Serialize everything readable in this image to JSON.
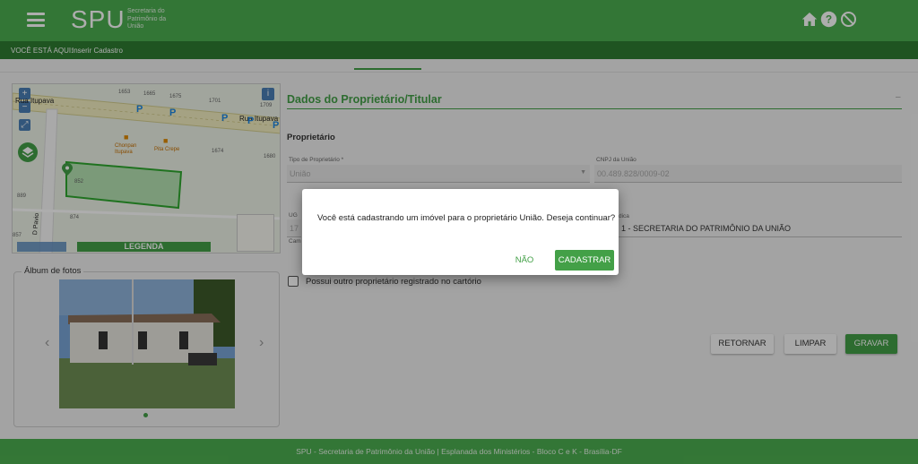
{
  "header": {
    "logo": "SPU",
    "logo_sub": [
      "Secretaria do",
      "Patrimônio da",
      "União"
    ],
    "icons": [
      "home-icon",
      "help-icon",
      "block-icon"
    ]
  },
  "breadcrumb": {
    "where_label": "VOCÊ ESTÁ AQUI:",
    "current": "Inserir Cadastro"
  },
  "map": {
    "street_labels": [
      "Rua Itupava",
      "Rua Itupava",
      "D Pavio"
    ],
    "numbers": [
      "1653",
      "1665",
      "1675",
      "1701",
      "1709",
      "1674",
      "1680",
      "852",
      "889",
      "874",
      "857"
    ],
    "pois": [
      "Chonpan Itupava",
      "Pita Crepe"
    ],
    "legend_label": "LEGENDA",
    "info_icon": "i"
  },
  "album": {
    "title": "Álbum de fotos"
  },
  "form": {
    "section_title": "Dados do Proprietário/Titular",
    "subheading": "Proprietário",
    "tipo_label": "Tipo de Proprietário *",
    "tipo_value": "União",
    "cnpj_label": "CNPJ da União",
    "cnpj_value": "00.489.828/0009-02",
    "ug_label_partial": "UG",
    "ug_value_partial": "17",
    "gestora_label_partial": "dica",
    "gestora_value": "1 - SECRETARIA DO PATRIMÔNIO DA UNIÃO",
    "cam_label_partial": "Cam",
    "checkbox_label": "Possui outro proprietário registrado no cartório"
  },
  "buttons": {
    "retornar": "RETORNAR",
    "limpar": "LIMPAR",
    "gravar": "GRAVAR"
  },
  "dialog": {
    "message": "Você está cadastrando um imóvel para o proprietário União. Deseja continuar?",
    "no_label": "NÃO",
    "yes_label": "CADASTRAR"
  },
  "footer": {
    "text": "SPU - Secretaria de Patrimônio da União | Esplanada dos Ministérios - Bloco C e K - Brasília-DF"
  },
  "colors": {
    "primary": "#4caf50",
    "primary_dark": "#2e7d32",
    "accent": "#43a047"
  }
}
